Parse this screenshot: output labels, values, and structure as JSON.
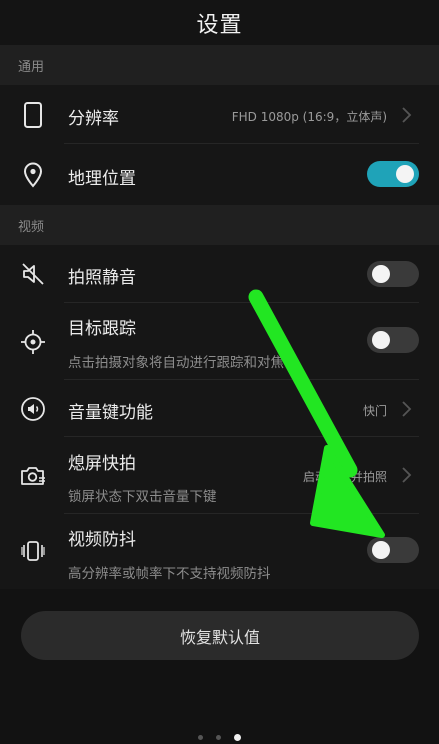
{
  "header": {
    "title": "设置"
  },
  "sections": {
    "general": "通用",
    "video": "视频"
  },
  "rows": {
    "resolution": {
      "label": "分辨率",
      "value": "FHD 1080p (16:9，立体声)",
      "icon": "phone-icon"
    },
    "location": {
      "label": "地理位置",
      "toggle": true,
      "icon": "location-pin-icon"
    },
    "mute": {
      "label": "拍照静音",
      "toggle": false,
      "icon": "mute-speaker-icon"
    },
    "tracking": {
      "label": "目标跟踪",
      "sub": "点击拍摄对象将自动进行跟踪和对焦",
      "toggle": false,
      "icon": "target-icon"
    },
    "volume_key": {
      "label": "音量键功能",
      "value": "快门",
      "icon": "volume-icon"
    },
    "screen_off_snap": {
      "label": "熄屏快拍",
      "sub": "锁屏状态下双击音量下键",
      "value": "启动相机并拍照",
      "icon": "quick-camera-icon"
    },
    "stabilization": {
      "label": "视频防抖",
      "sub": "高分辨率或帧率下不支持视频防抖",
      "toggle": false,
      "icon": "stabilize-icon"
    }
  },
  "reset": {
    "label": "恢复默认值"
  },
  "pager": {
    "count": 3,
    "active_index": 2
  },
  "colors": {
    "accent": "#1fa3b8",
    "annotation_arrow": "#22e622"
  }
}
